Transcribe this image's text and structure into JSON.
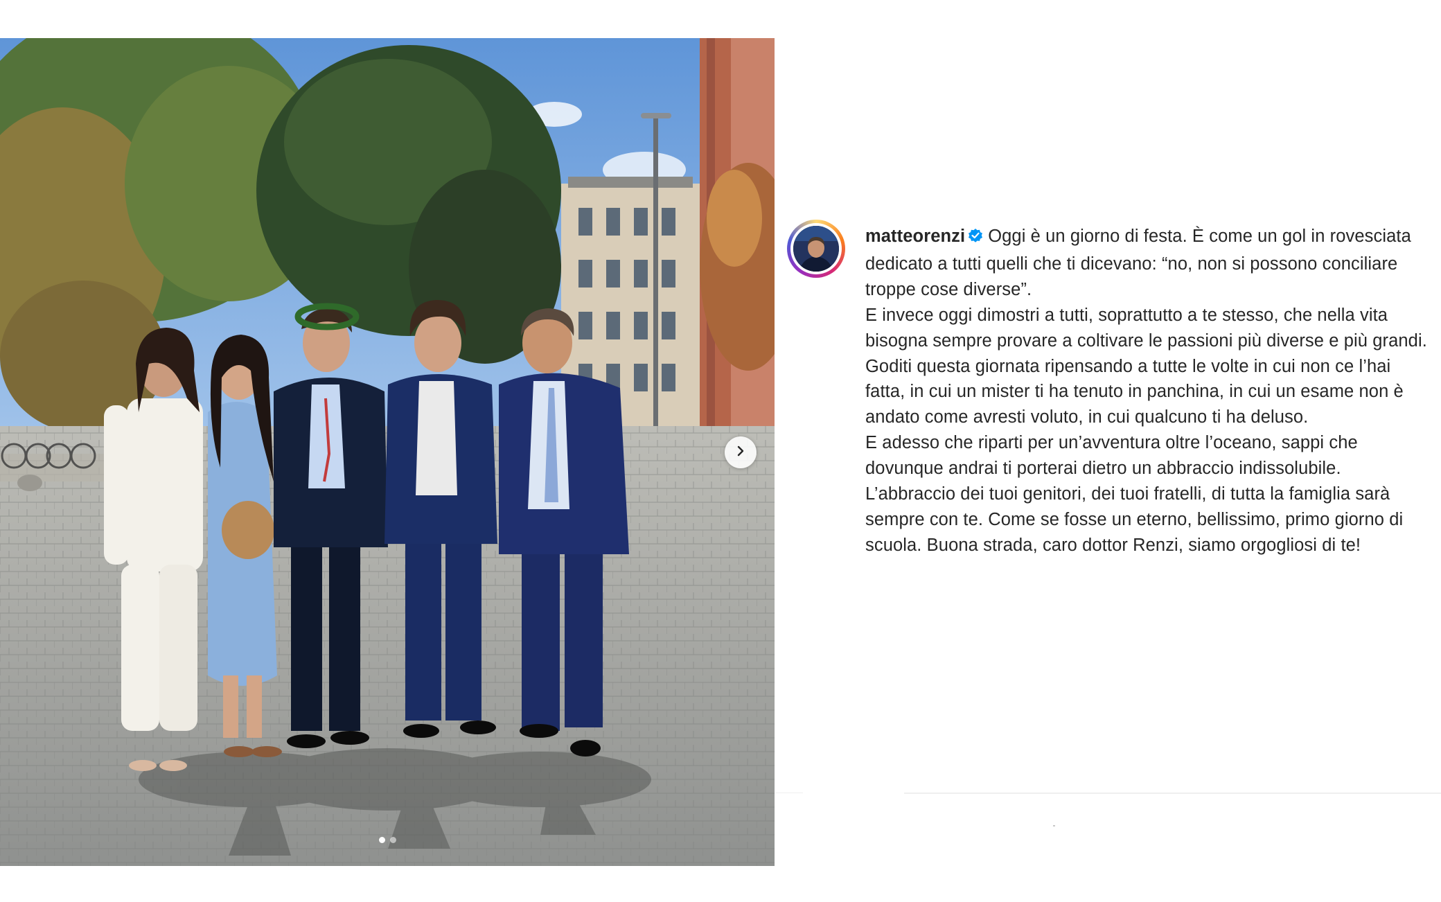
{
  "post": {
    "username": "matteorenzi",
    "verified": true,
    "caption_lines": [
      "Oggi è un giorno di festa. È come un gol in rovesciata dedicato a tutti quelli che ti dicevano: “no, non si possono conciliare troppe cose diverse”.",
      "E invece oggi dimostri a tutti, soprattutto a te stesso, che nella vita bisogna sempre provare a coltivare le passioni più diverse e più grandi. Goditi questa giornata ripensando a tutte le volte in cui non ce l’hai fatta, in cui un mister ti ha tenuto in panchina, in cui un esame non è andato come avresti voluto, in cui qualcuno ti ha deluso.",
      "E adesso che riparti per un’avventura oltre l’oceano, sappi che dovunque andrai ti porterai dietro un abbraccio indissolubile. L’abbraccio dei tuoi genitori, dei tuoi fratelli, di tutta la famiglia sarà sempre con te. Come se fosse un eterno, bellissimo, primo giorno di scuola. Buona strada, caro dottor Renzi, siamo orgogliosi di te!"
    ]
  },
  "carousel": {
    "current": 1,
    "total": 2
  },
  "icons": {
    "next": "chevron-right-icon",
    "verified": "verified-badge-icon"
  },
  "colors": {
    "verified": "#0095f6",
    "text": "#262626",
    "ring_start": "#feda75",
    "ring_mid": "#d62976",
    "ring_end": "#4f5bd5"
  }
}
